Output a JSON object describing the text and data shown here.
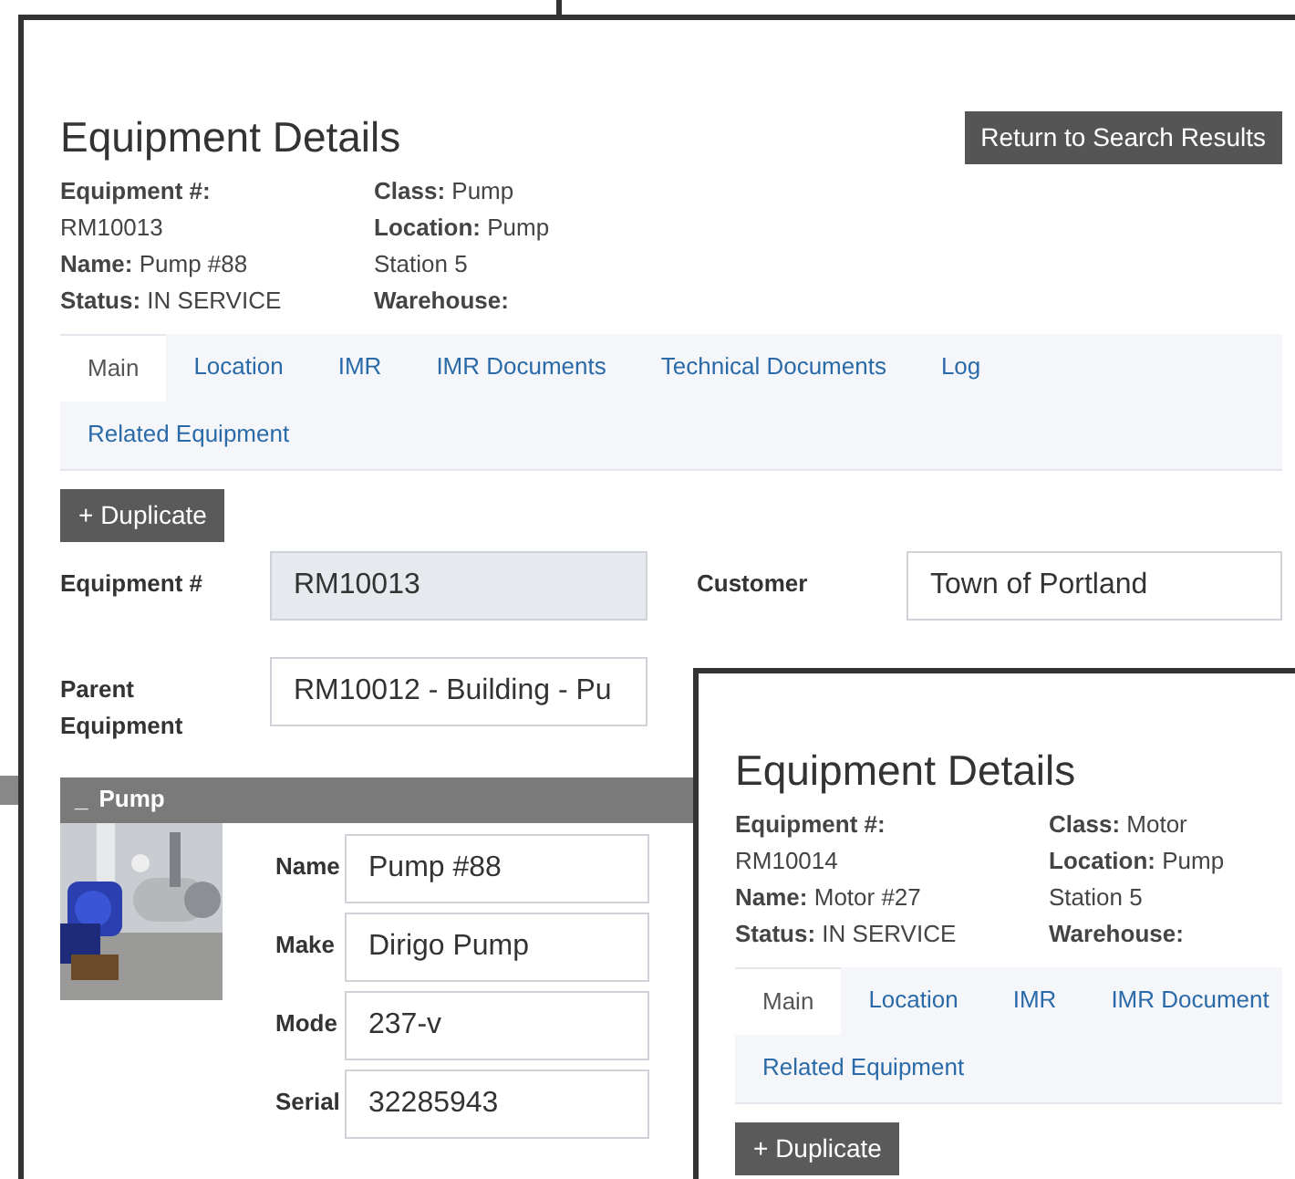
{
  "windows": [
    {
      "title": "Equipment Details",
      "return_button": "Return to Search Results",
      "info_columns": [
        [
          "**Equipment #:** RM10013",
          "**Name:** Pump #88",
          "**Status:** IN SERVICE"
        ],
        [
          "**Class:** Pump",
          "**Location:** Pump Station 5",
          "**Warehouse:**"
        ]
      ],
      "tab_rows": [
        [
          {
            "label": "Main",
            "selected": true
          },
          {
            "label": "Location",
            "selected": false
          },
          {
            "label": "IMR",
            "selected": false
          },
          {
            "label": "IMR Documents",
            "selected": false
          },
          {
            "label": "Technical Documents",
            "selected": false
          },
          {
            "label": "Log",
            "selected": false
          }
        ],
        [
          {
            "label": "Related Equipment",
            "selected": false
          }
        ]
      ],
      "duplicate_button": "+ Duplicate",
      "form": {
        "rows": [
          [
            {
              "label": "Equipment #",
              "value": "RM10013",
              "disabled": true
            },
            {
              "label": "Customer",
              "value": "Town of Portland",
              "disabled": false
            }
          ],
          [
            {
              "label": "Parent Equipment",
              "value": "RM10012 - Building - Pu",
              "disabled": false
            }
          ]
        ],
        "section": {
          "toggle": "_",
          "title": "Pump",
          "fields": [
            {
              "label": "Name",
              "value": "Pump #88"
            },
            {
              "label": "Make",
              "value": "Dirigo Pump"
            },
            {
              "label": "Mode",
              "value": "237-v"
            },
            {
              "label": "Serial",
              "value": "32285943"
            }
          ]
        }
      }
    },
    {
      "title": "Equipment Details",
      "info_columns": [
        [
          "**Equipment #:** RM10014",
          "**Name:** Motor #27",
          "**Status:** IN SERVICE"
        ],
        [
          "**Class:** Motor",
          "**Location:** Pump Station 5",
          "**Warehouse:**"
        ]
      ],
      "tab_rows": [
        [
          {
            "label": "Main",
            "selected": true
          },
          {
            "label": "Location",
            "selected": false
          },
          {
            "label": "IMR",
            "selected": false
          },
          {
            "label": "IMR Document",
            "selected": false
          }
        ],
        [
          {
            "label": "Related Equipment",
            "selected": false
          }
        ]
      ],
      "duplicate_button": "+ Duplicate"
    }
  ]
}
